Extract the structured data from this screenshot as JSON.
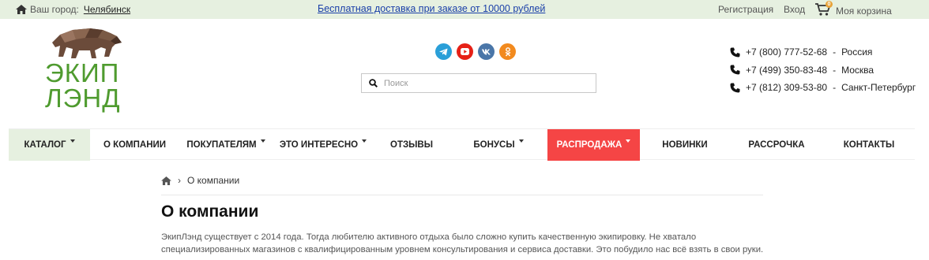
{
  "topbar": {
    "city_label": "Ваш город:",
    "city_value": "Челябинск",
    "promo": "Бесплатная доставка при заказе от 10000 рублей",
    "register": "Регистрация",
    "login": "Вход",
    "cart_count": "0",
    "cart_label": "Моя корзина"
  },
  "logo": {
    "line1": "ЭКИП",
    "line2": "ЛЭНД",
    "brand_color": "#4f9b2f"
  },
  "socials": [
    {
      "name": "telegram",
      "icon": "telegram-icon",
      "color": "#2a9fd8"
    },
    {
      "name": "youtube",
      "icon": "youtube-icon",
      "color": "#e62117"
    },
    {
      "name": "vk",
      "icon": "vk-icon",
      "color": "#4a76a8"
    },
    {
      "name": "odnoklassniki",
      "icon": "ok-icon",
      "color": "#f28a1e"
    }
  ],
  "search": {
    "placeholder": "Поиск"
  },
  "phones": [
    {
      "number": "+7 (800) 777-52-68",
      "region": "Россия"
    },
    {
      "number": "+7 (499) 350-83-48",
      "region": "Москва"
    },
    {
      "number": "+7 (812) 309-53-80",
      "region": "Санкт-Петербург"
    }
  ],
  "nav": [
    {
      "label": "Каталог"
    },
    {
      "label": "О компании"
    },
    {
      "label": "Покупателям"
    },
    {
      "label": "Это интересно"
    },
    {
      "label": "Отзывы"
    },
    {
      "label": "Бонусы"
    },
    {
      "label": "Распродажа"
    },
    {
      "label": "Новинки"
    },
    {
      "label": "Рассрочка"
    },
    {
      "label": "Контакты"
    }
  ],
  "breadcrumb": {
    "current": "О компании"
  },
  "page": {
    "title": "О компании",
    "paragraph_line1": "ЭкипЛэнд существует с 2014 года. Тогда любителю активного отдыха было сложно купить качественную экипировку. Не хватало",
    "paragraph_line2": "специализированных магазинов с квалифицированным уровнем консультирования и сервиса доставки. Это побудило нас всё взять в свои руки."
  },
  "colors": {
    "topbar_bg": "#e6f0e0",
    "sale_bg": "#f54545",
    "link": "#1a3fa8"
  }
}
